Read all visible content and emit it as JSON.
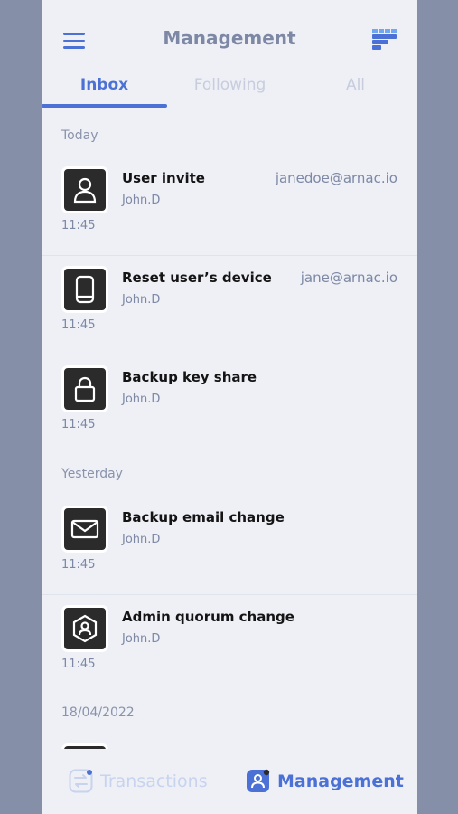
{
  "header": {
    "title": "Management",
    "menu_icon": "hamburger-menu-icon",
    "logo_icon": "arnac-logo-icon"
  },
  "tabs": [
    {
      "label": "Inbox",
      "active": true
    },
    {
      "label": "Following",
      "active": false
    },
    {
      "label": "All",
      "active": false
    }
  ],
  "sections": [
    {
      "label": "Today",
      "items": [
        {
          "title": "User invite",
          "user": "John.D",
          "email": "janedoe@arnac.io",
          "time": "11:45",
          "icon": "user-icon"
        },
        {
          "title": "Reset user’s device",
          "user": "John.D",
          "email": "jane@arnac.io",
          "time": "11:45",
          "icon": "device-icon"
        },
        {
          "title": "Backup key share",
          "user": "John.D",
          "email": "",
          "time": "11:45",
          "icon": "lock-icon"
        }
      ]
    },
    {
      "label": "Yesterday",
      "items": [
        {
          "title": "Backup email change",
          "user": "John.D",
          "email": "",
          "time": "11:45",
          "icon": "envelope-icon"
        },
        {
          "title": "Admin quorum change",
          "user": "John.D",
          "email": "",
          "time": "11:45",
          "icon": "admin-shield-icon"
        }
      ]
    },
    {
      "label": "18/04/2022",
      "items": []
    }
  ],
  "bottom_nav": [
    {
      "label": "Transactions",
      "active": false,
      "icon": "transactions-icon"
    },
    {
      "label": "Management",
      "active": true,
      "icon": "management-icon"
    }
  ],
  "colors": {
    "accent": "#4b71d6",
    "muted": "#7d88a5",
    "background": "#eef0f6",
    "outer": "#8590a8"
  }
}
